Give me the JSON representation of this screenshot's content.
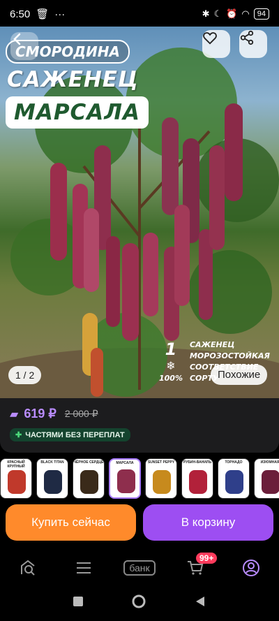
{
  "status": {
    "time": "6:50",
    "battery": "94"
  },
  "hero": {
    "title_line1": "СМОРОДИНА",
    "title_line2": "САЖЕНЕЦ",
    "title_line3": "МАРСАЛА",
    "frost_num": "1",
    "frost_pct": "100%",
    "frost_text_1": "САЖЕНЕЦ",
    "frost_text_2": "МОРОЗОСТОЙКАЯ",
    "frost_text_3": "СООТВЕТСТВИЕ СОРТУ",
    "counter": "1 / 2",
    "similar_label": "Похожие"
  },
  "price": {
    "current": "619 ₽",
    "old": "2 000 ₽",
    "installment": "ЧАСТЯМИ БЕЗ ПЕРЕПЛАТ"
  },
  "variants": [
    {
      "label": "КРАСНЫЙ КРУПНЫЙ",
      "color": "#c0392b"
    },
    {
      "label": "BLACK TITAN",
      "color": "#1f2a44"
    },
    {
      "label": "ЧЁРНОЕ СЕРДЦЕ",
      "color": "#3a2a1a"
    },
    {
      "label": "МАРСАЛА",
      "color": "#8e2e4d"
    },
    {
      "label": "SUNSET PEPPY",
      "color": "#c78a1d"
    },
    {
      "label": "РУБИН-ВАНИЛЬ",
      "color": "#b2213a"
    },
    {
      "label": "ТОРНАДО",
      "color": "#2f3f8a"
    },
    {
      "label": "ИЗЮМНАЯ",
      "color": "#6b1e3a"
    }
  ],
  "actions": {
    "buy_now": "Купить сейчас",
    "to_cart": "В корзину"
  },
  "nav": {
    "bank": "банк",
    "cart_badge": "99+"
  },
  "colors": {
    "accent_purple": "#9d4ef2",
    "accent_orange": "#ff8a2b",
    "installment_bg": "#14432e"
  }
}
